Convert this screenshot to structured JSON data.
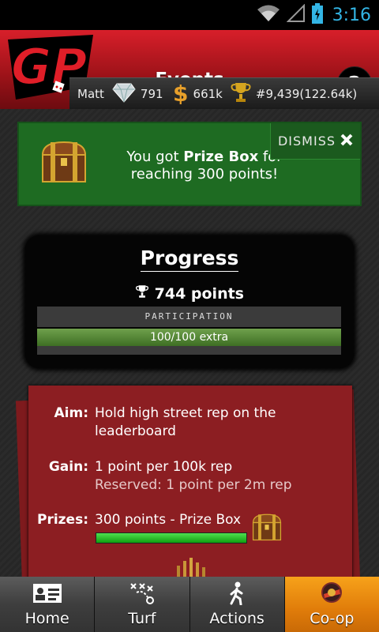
{
  "status_bar": {
    "time": "3:16"
  },
  "header": {
    "title": "Events",
    "help_label": "?",
    "logo_text": "GP"
  },
  "stats": {
    "username": "Matt",
    "diamonds": "791",
    "cash": "661k",
    "rank": "#9,439(122.64k)"
  },
  "banner": {
    "text_prefix": "You got ",
    "prize_name": "Prize Box",
    "text_suffix": " for reaching 300 points!",
    "dismiss_label": "DISMISS"
  },
  "progress": {
    "title": "Progress",
    "points": "744 points",
    "participation_label": "PARTICIPATION",
    "participation_value": "100/100 extra",
    "participation_fraction": 1.0
  },
  "event": {
    "aim_label": "Aim:",
    "aim_value": "Hold high street rep on the leaderboard",
    "gain_label": "Gain:",
    "gain_value": "1 point per 100k rep",
    "gain_reserved": "Reserved: 1 point per 2m rep",
    "prizes_label": "Prizes:",
    "prizes_value": "300 points - Prize Box",
    "prize_progress_fraction": 1.0
  },
  "nav": {
    "home": "Home",
    "turf": "Turf",
    "actions": "Actions",
    "coop": "Co-op"
  },
  "colors": {
    "header_red": "#d81f2a",
    "banner_green": "#1e6b22",
    "card_red": "#8c1e22",
    "nav_active": "#f7a21a",
    "status_time": "#33b5e5"
  }
}
